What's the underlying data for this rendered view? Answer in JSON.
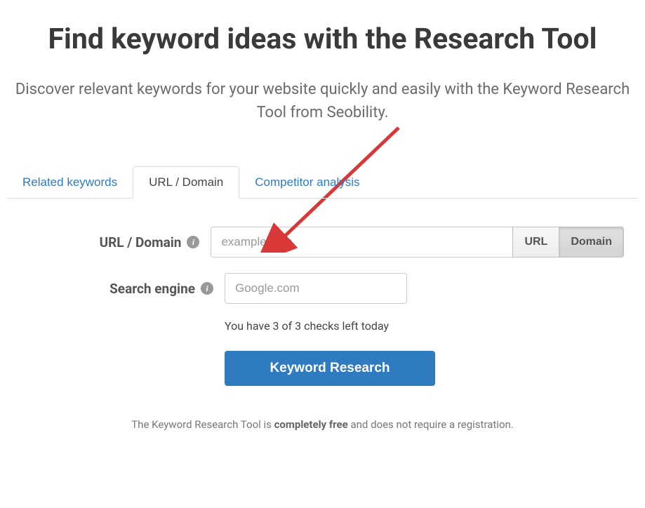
{
  "header": {
    "title": "Find keyword ideas with the Research Tool",
    "subtitle": "Discover relevant keywords for your website quickly and easily with the Keyword Research Tool from Seobility."
  },
  "tabs": {
    "items": [
      {
        "label": "Related keywords",
        "active": false
      },
      {
        "label": "URL / Domain",
        "active": true
      },
      {
        "label": "Competitor analysis",
        "active": false
      }
    ]
  },
  "form": {
    "url_domain": {
      "label": "URL / Domain",
      "placeholder": "example.com",
      "value": "",
      "toggle": {
        "url_label": "URL",
        "domain_label": "Domain",
        "active": "domain"
      }
    },
    "search_engine": {
      "label": "Search engine",
      "placeholder": "Google.com",
      "value": ""
    },
    "checks_remaining": "You have 3 of 3 checks left today",
    "submit_label": "Keyword Research"
  },
  "footer": {
    "prefix": "The Keyword Research Tool is ",
    "bold": "completely free",
    "suffix": " and does not require a registration."
  },
  "colors": {
    "accent": "#2f7bbf",
    "arrow": "#d93838"
  }
}
